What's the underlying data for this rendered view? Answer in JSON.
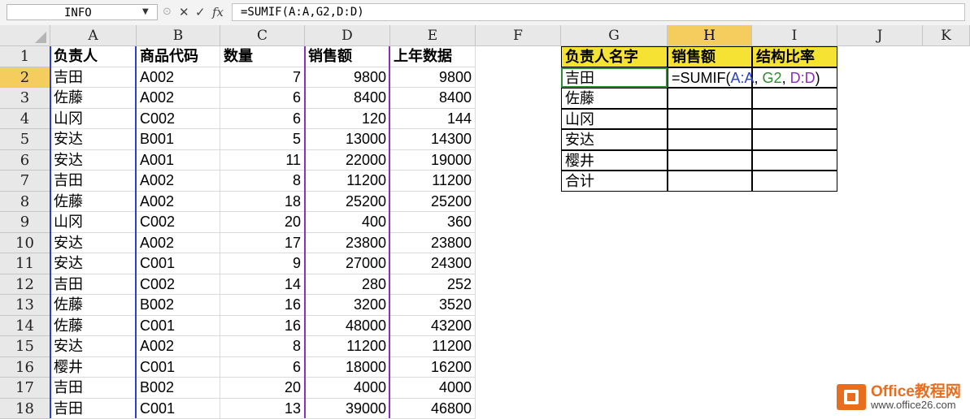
{
  "formula_bar": {
    "name_box": "INFO",
    "formula": "=SUMIF(A:A,G2,D:D)",
    "cancel_glyph": "✕",
    "enter_glyph": "✓",
    "fx_glyph": "fx"
  },
  "columns": [
    "A",
    "B",
    "C",
    "D",
    "E",
    "F",
    "G",
    "H",
    "I",
    "J",
    "K"
  ],
  "rows": [
    "1",
    "2",
    "3",
    "4",
    "5",
    "6",
    "7",
    "8",
    "9",
    "10",
    "11",
    "12",
    "13",
    "14",
    "15",
    "16",
    "17",
    "18"
  ],
  "headers": {
    "A1": "负责人",
    "B1": "商品代码",
    "C1": "数量",
    "D1": "销售额",
    "E1": "上年数据",
    "G1": "负责人名字",
    "H1": "销售额",
    "I1": "结构比率"
  },
  "data_rows": [
    {
      "a": "吉田",
      "b": "A002",
      "c": "7",
      "d": "9800",
      "e": "9800"
    },
    {
      "a": "佐藤",
      "b": "A002",
      "c": "6",
      "d": "8400",
      "e": "8400"
    },
    {
      "a": "山冈",
      "b": "C002",
      "c": "6",
      "d": "120",
      "e": "144"
    },
    {
      "a": "安达",
      "b": "B001",
      "c": "5",
      "d": "13000",
      "e": "14300"
    },
    {
      "a": "安达",
      "b": "A001",
      "c": "11",
      "d": "22000",
      "e": "19000"
    },
    {
      "a": "吉田",
      "b": "A002",
      "c": "8",
      "d": "11200",
      "e": "11200"
    },
    {
      "a": "佐藤",
      "b": "A002",
      "c": "18",
      "d": "25200",
      "e": "25200"
    },
    {
      "a": "山冈",
      "b": "C002",
      "c": "20",
      "d": "400",
      "e": "360"
    },
    {
      "a": "安达",
      "b": "A002",
      "c": "17",
      "d": "23800",
      "e": "23800"
    },
    {
      "a": "安达",
      "b": "C001",
      "c": "9",
      "d": "27000",
      "e": "24300"
    },
    {
      "a": "吉田",
      "b": "C002",
      "c": "14",
      "d": "280",
      "e": "252"
    },
    {
      "a": "佐藤",
      "b": "B002",
      "c": "16",
      "d": "3200",
      "e": "3520"
    },
    {
      "a": "佐藤",
      "b": "C001",
      "c": "16",
      "d": "48000",
      "e": "43200"
    },
    {
      "a": "安达",
      "b": "A002",
      "c": "8",
      "d": "11200",
      "e": "11200"
    },
    {
      "a": "樱井",
      "b": "C001",
      "c": "6",
      "d": "18000",
      "e": "16200"
    },
    {
      "a": "吉田",
      "b": "B002",
      "c": "20",
      "d": "4000",
      "e": "4000"
    },
    {
      "a": "吉田",
      "b": "C001",
      "c": "13",
      "d": "39000",
      "e": "46800"
    }
  ],
  "summary_names": [
    "吉田",
    "佐藤",
    "山冈",
    "安达",
    "樱井",
    "合计"
  ],
  "editing_cell_formula": {
    "prefix": "=SUMIF(",
    "ref1": "A:A",
    "sep1": ", ",
    "ref2": "G2",
    "sep2": ", ",
    "ref3": "D:D",
    "suffix": ")"
  },
  "colors": {
    "header_yellow": "#f6e232",
    "ref_blue": "#2b3ed6",
    "ref_green": "#2e8b30",
    "ref_purple": "#8a2fc0",
    "selected_header": "#f5cd5e"
  },
  "watermark": {
    "title": "Office教程网",
    "url": "www.office26.com",
    "icon": "office-logo-icon"
  }
}
